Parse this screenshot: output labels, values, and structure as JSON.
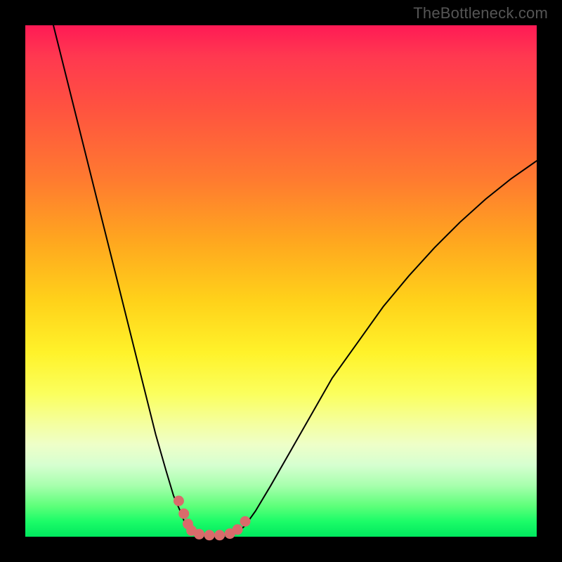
{
  "watermark": "TheBottleneck.com",
  "colors": {
    "background": "#000000",
    "curve": "#000000",
    "marker": "#d96b6b",
    "gradient_top": "#ff1a55",
    "gradient_bottom": "#00e85e"
  },
  "chart_data": {
    "type": "line",
    "title": "",
    "xlabel": "",
    "ylabel": "",
    "xlim": [
      0,
      100
    ],
    "ylim": [
      0,
      100
    ],
    "grid": false,
    "legend": false,
    "series": [
      {
        "name": "bottleneck-curve-left",
        "x": [
          5.5,
          8,
          11,
          14,
          17,
          20,
          23,
          25.5,
          27.5,
          29,
          30.3,
          31,
          31.8,
          32.5
        ],
        "y": [
          100,
          90,
          78,
          66,
          54,
          42,
          30,
          20,
          13,
          8,
          5,
          3.2,
          1.8,
          0.8
        ]
      },
      {
        "name": "bottleneck-curve-floor",
        "x": [
          32.5,
          34,
          36,
          38,
          40,
          41.5
        ],
        "y": [
          0.8,
          0.3,
          0.15,
          0.15,
          0.3,
          0.8
        ]
      },
      {
        "name": "bottleneck-curve-right",
        "x": [
          41.5,
          43,
          45,
          48,
          52,
          56,
          60,
          65,
          70,
          75,
          80,
          85,
          90,
          95,
          100
        ],
        "y": [
          0.8,
          2.2,
          5,
          10,
          17,
          24,
          31,
          38,
          45,
          51,
          56.5,
          61.5,
          66,
          70,
          73.5
        ]
      }
    ],
    "annotations": [
      {
        "name": "highlighted-region",
        "shape": "dotted-v",
        "x": [
          30,
          31,
          31.8,
          32.5,
          34,
          36,
          38,
          40,
          41.5,
          43
        ],
        "y": [
          7,
          4.5,
          2.5,
          1.2,
          0.5,
          0.3,
          0.3,
          0.6,
          1.4,
          3
        ],
        "color": "#d96b6b"
      }
    ]
  }
}
